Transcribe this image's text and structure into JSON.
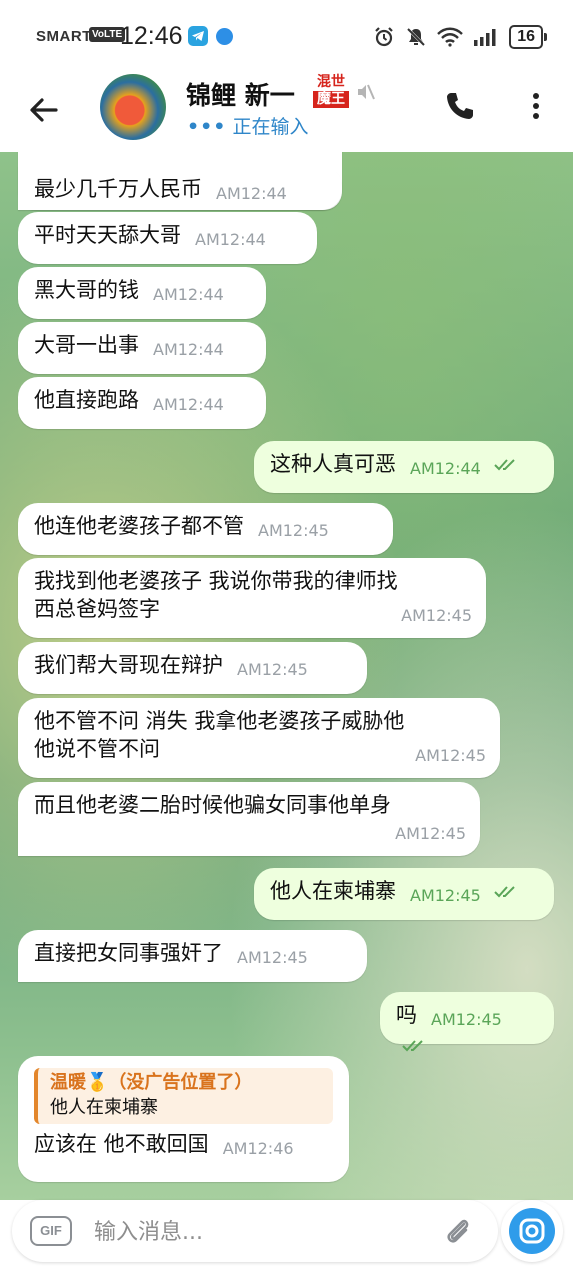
{
  "status_bar": {
    "carrier": "SMART",
    "network_badge": "VoLTE",
    "time": "12:46",
    "battery": "16",
    "icons": [
      "telegram-icon",
      "browser-icon",
      "alarm-icon",
      "do-not-disturb-icon",
      "wifi-icon",
      "signal-icon"
    ]
  },
  "header": {
    "contact_name": "锦鲤 新一",
    "title_badge_line1": "混世",
    "title_badge_line2": "魔王",
    "status_dots": "•••",
    "status_text": "正在输入",
    "icons": [
      "back-arrow-icon",
      "mute-icon",
      "phone-icon",
      "more-vert-icon"
    ]
  },
  "messages": [
    {
      "dir": "in",
      "text": "最少几千万人民币",
      "time": "AM12:44"
    },
    {
      "dir": "in",
      "text": "平时天天舔大哥",
      "time": "AM12:44"
    },
    {
      "dir": "in",
      "text": "黑大哥的钱",
      "time": "AM12:44"
    },
    {
      "dir": "in",
      "text": "大哥一出事",
      "time": "AM12:44"
    },
    {
      "dir": "in",
      "text": "他直接跑路",
      "time": "AM12:44"
    },
    {
      "dir": "out",
      "text": "这种人真可恶",
      "time": "AM12:44"
    },
    {
      "dir": "in",
      "text": "他连他老婆孩子都不管",
      "time": "AM12:45"
    },
    {
      "dir": "in",
      "line1": "我找到他老婆孩子 我说你带我的律师找",
      "line2": "西总爸妈签字",
      "time": "AM12:45"
    },
    {
      "dir": "in",
      "text": "我们帮大哥现在辩护",
      "time": "AM12:45"
    },
    {
      "dir": "in",
      "line1": "他不管不问 消失 我拿他老婆孩子威胁他",
      "line2": "他说不管不问",
      "time": "AM12:45"
    },
    {
      "dir": "in",
      "line1": "而且他老婆二胎时候他骗女同事他单身",
      "time": "AM12:45"
    },
    {
      "dir": "out",
      "text": "他人在柬埔寨",
      "time": "AM12:45"
    },
    {
      "dir": "in",
      "text": "直接把女同事强奸了",
      "time": "AM12:45"
    },
    {
      "dir": "out",
      "text": "吗",
      "time": "AM12:45"
    },
    {
      "dir": "in",
      "reply_name": "温暖🥇（没广告位置了）",
      "reply_text": "他人在柬埔寨",
      "text": "应该在 他不敢回国",
      "time": "AM12:46"
    }
  ],
  "input": {
    "gif_label": "GIF",
    "placeholder": "输入消息...",
    "icons": [
      "attach-icon",
      "camera-icon"
    ]
  },
  "colors": {
    "accent": "#2f9cea",
    "typing": "#2f86c9",
    "out_bubble": "#eeffde",
    "check": "#5aa558",
    "reply_bar": "#e3862b"
  }
}
